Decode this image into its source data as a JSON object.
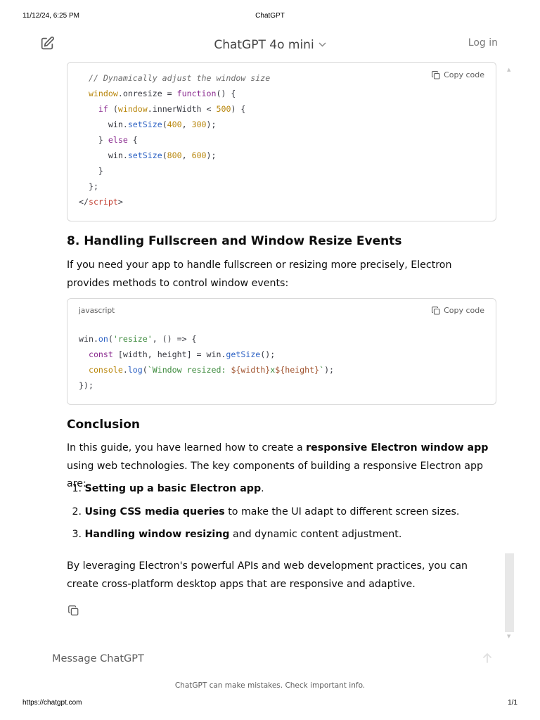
{
  "print_header": {
    "datetime": "11/12/24, 6:25 PM",
    "title": "ChatGPT"
  },
  "print_footer": {
    "url": "https://chatgpt.com",
    "page": "1/1"
  },
  "topbar": {
    "model_name": "ChatGPT 4o mini",
    "login_label": "Log in",
    "new_chat_icon": "edit-icon"
  },
  "code_block_1": {
    "copy_label": "Copy code",
    "lines": {
      "l1": "  // Dynamically adjust the window size",
      "l2a": "  ",
      "l2_window": "window",
      "l2b": ".onresize = ",
      "l2_function": "function",
      "l2c": "() {",
      "l3a": "    ",
      "l3_if": "if",
      "l3b": " (",
      "l3_window": "window",
      "l3c": ".innerWidth < ",
      "l3_num": "500",
      "l3d": ") {",
      "l4a": "      win.",
      "l4_fn": "setSize",
      "l4b": "(",
      "l4_n1": "400",
      "l4c": ", ",
      "l4_n2": "300",
      "l4d": ");",
      "l5a": "    } ",
      "l5_else": "else",
      "l5b": " {",
      "l6a": "      win.",
      "l6_fn": "setSize",
      "l6b": "(",
      "l6_n1": "800",
      "l6c": ", ",
      "l6_n2": "600",
      "l6d": ");",
      "l7": "    }",
      "l8": "  };",
      "l9a": "</",
      "l9_tag": "script",
      "l9b": ">"
    }
  },
  "section_8": {
    "heading": "8. Handling Fullscreen and Window Resize Events",
    "intro": "If you need your app to handle fullscreen or resizing more precisely, Electron provides methods to control window events:"
  },
  "code_block_2": {
    "language": "javascript",
    "copy_label": "Copy code",
    "lines": {
      "l1a": "win.",
      "l1_on": "on",
      "l1b": "(",
      "l1_str": "'resize'",
      "l1c": ", () => {",
      "l2a": "  ",
      "l2_const": "const",
      "l2b": " [width, height] = win.",
      "l2_fn": "getSize",
      "l2c": "();",
      "l3a": "  ",
      "l3_console": "console",
      "l3b": ".",
      "l3_log": "log",
      "l3c": "(",
      "l3_str1": "`Window resized: ",
      "l3_t1": "${width}",
      "l3_str2": "x",
      "l3_t2": "${height}",
      "l3_str3": "`",
      "l3d": ");",
      "l4": "});"
    }
  },
  "conclusion": {
    "heading": "Conclusion",
    "p1_before": "In this guide, you have learned how to create a ",
    "p1_bold": "responsive Electron window app",
    "p1_after": " using web technologies. The key components of building a responsive Electron app are:",
    "items": [
      {
        "num": "1.",
        "bold": "Setting up a basic Electron app",
        "rest": "."
      },
      {
        "num": "2.",
        "bold": "Using CSS media queries",
        "rest": " to make the UI adapt to different screen sizes."
      },
      {
        "num": "3.",
        "bold": "Handling window resizing",
        "rest": " and dynamic content adjustment."
      }
    ],
    "closing": "By leveraging Electron's powerful APIs and web development practices, you can create cross-platform desktop apps that are responsive and adaptive."
  },
  "composer": {
    "placeholder": "Message ChatGPT"
  },
  "disclaimer": "ChatGPT can make mistakes. Check important info."
}
